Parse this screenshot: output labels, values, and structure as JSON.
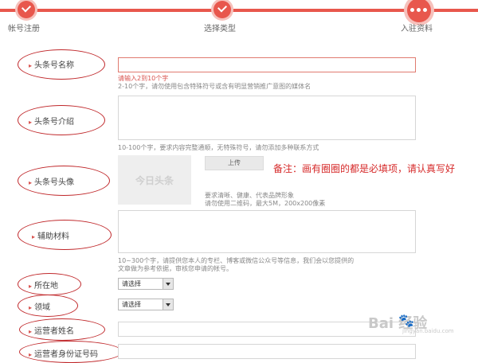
{
  "steps": [
    {
      "label": "帐号注册",
      "state": "done"
    },
    {
      "label": "选择类型",
      "state": "done"
    },
    {
      "label": "入驻资料",
      "state": "current"
    }
  ],
  "fields": {
    "name": {
      "label": "头条号名称",
      "error": "请输入2到10个字",
      "hint": "2-10个字，请勿使用包含特殊符号或含有明显营销推广意图的媒体名"
    },
    "intro": {
      "label": "头条号介绍",
      "hint": "10-100个字，要求内容完整通顺，无特殊符号，请勿添加多种联系方式"
    },
    "avatar": {
      "label": "头条号头像",
      "placeholder_text": "今日头条",
      "upload_label": "上传",
      "hint1": "要求清晰、健康、代表品牌形象",
      "hint2": "请勿使用二维码，最大5M，200x200像素"
    },
    "material": {
      "label": "辅助材料",
      "hint1": "10~300个字，请提供您本人的专栏、博客或微信公众号等信息，我们会以您提供的",
      "hint2": "文章做为参考依据，审核您申请的帐号。"
    },
    "location": {
      "label": "所在地",
      "select_value": "请选择"
    },
    "domain": {
      "label": "领域",
      "select_value": "请选择"
    },
    "operator_name": {
      "label": "运营者姓名"
    },
    "operator_id": {
      "label": "运营者身份证号码"
    }
  },
  "note": "备注：画有圈圈的都是必填项，请认真写好",
  "watermark": {
    "text": "Bai  经验",
    "sub": "jingyan.baidu.com"
  },
  "colors": {
    "accent": "#e8574d",
    "annotation": "#c0282b"
  }
}
